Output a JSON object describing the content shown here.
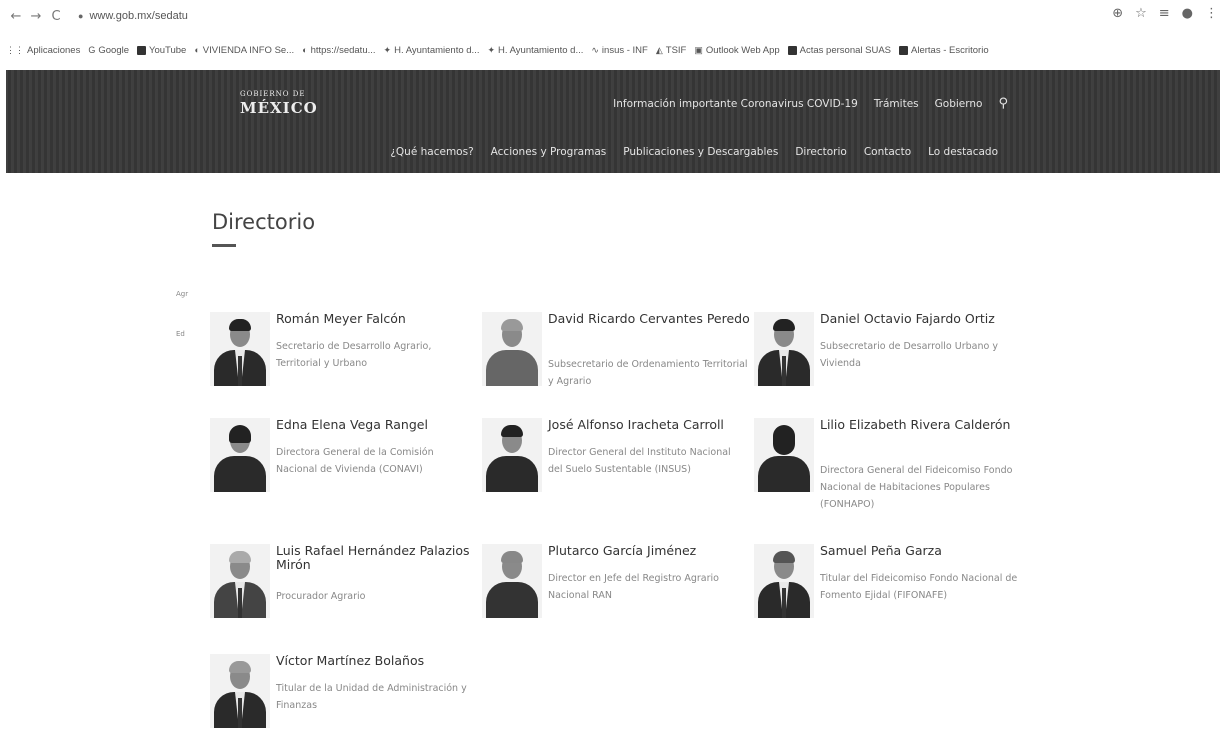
{
  "browser": {
    "url": "www.gob.mx/sedatu",
    "bookmarks": [
      "Aplicaciones",
      "Google",
      "YouTube",
      "VIVIENDA INFO Se...",
      "https://sedatu...",
      "H. Ayuntamiento d...",
      "H. Ayuntamiento d...",
      "insus - INF",
      "TSIF",
      "Outlook Web App",
      "Actas personal SUAS",
      "Alertas - Escritorio"
    ]
  },
  "header": {
    "logo_sub": "GOBIERNO DE",
    "logo_main": "MÉXICO",
    "top_nav": [
      "Información importante Coronavirus COVID-19",
      "Trámites",
      "Gobierno"
    ],
    "main_nav": [
      "¿Qué hacemos?",
      "Acciones y Programas",
      "Publicaciones y Descargables",
      "Directorio",
      "Contacto",
      "Lo destacado"
    ]
  },
  "page": {
    "title": "Directorio",
    "side_labels": [
      "Agr",
      "Ed"
    ]
  },
  "people": [
    {
      "name": "Román Meyer Falcón",
      "role": "Secretario de Desarrollo Agrario, Territorial y Urbano"
    },
    {
      "name": "David Ricardo Cervantes Peredo",
      "role": "Subsecretario de Ordenamiento Territorial y Agrario"
    },
    {
      "name": "Daniel Octavio Fajardo Ortiz",
      "role": "Subsecretario de Desarrollo Urbano y Vivienda"
    },
    {
      "name": "Edna Elena Vega Rangel",
      "role": "Directora General de la Comisión Nacional de Vivienda (CONAVI)"
    },
    {
      "name": "José Alfonso Iracheta Carroll",
      "role": "Director General del Instituto Nacional del Suelo Sustentable (INSUS)"
    },
    {
      "name": "Lilio Elizabeth Rivera Calderón",
      "role": "Directora General del Fideicomiso Fondo Nacional de Habitaciones Populares (FONHAPO)"
    },
    {
      "name": "Luis Rafael Hernández Palazios Mirón",
      "role": "Procurador Agrario"
    },
    {
      "name": "Plutarco García Jiménez",
      "role": "Director en Jefe del Registro Agrario Nacional RAN"
    },
    {
      "name": "Samuel Peña Garza",
      "role": "Titular del Fideicomiso Fondo Nacional de Fomento Ejidal (FIFONAFE)"
    },
    {
      "name": "Víctor Martínez Bolaños",
      "role": "Titular de la Unidad de Administración y Finanzas"
    }
  ],
  "colors": {
    "header_bg": "#3a3a3a",
    "header_text": "#e4e4e4",
    "title": "#444444",
    "role_text": "#888888"
  }
}
